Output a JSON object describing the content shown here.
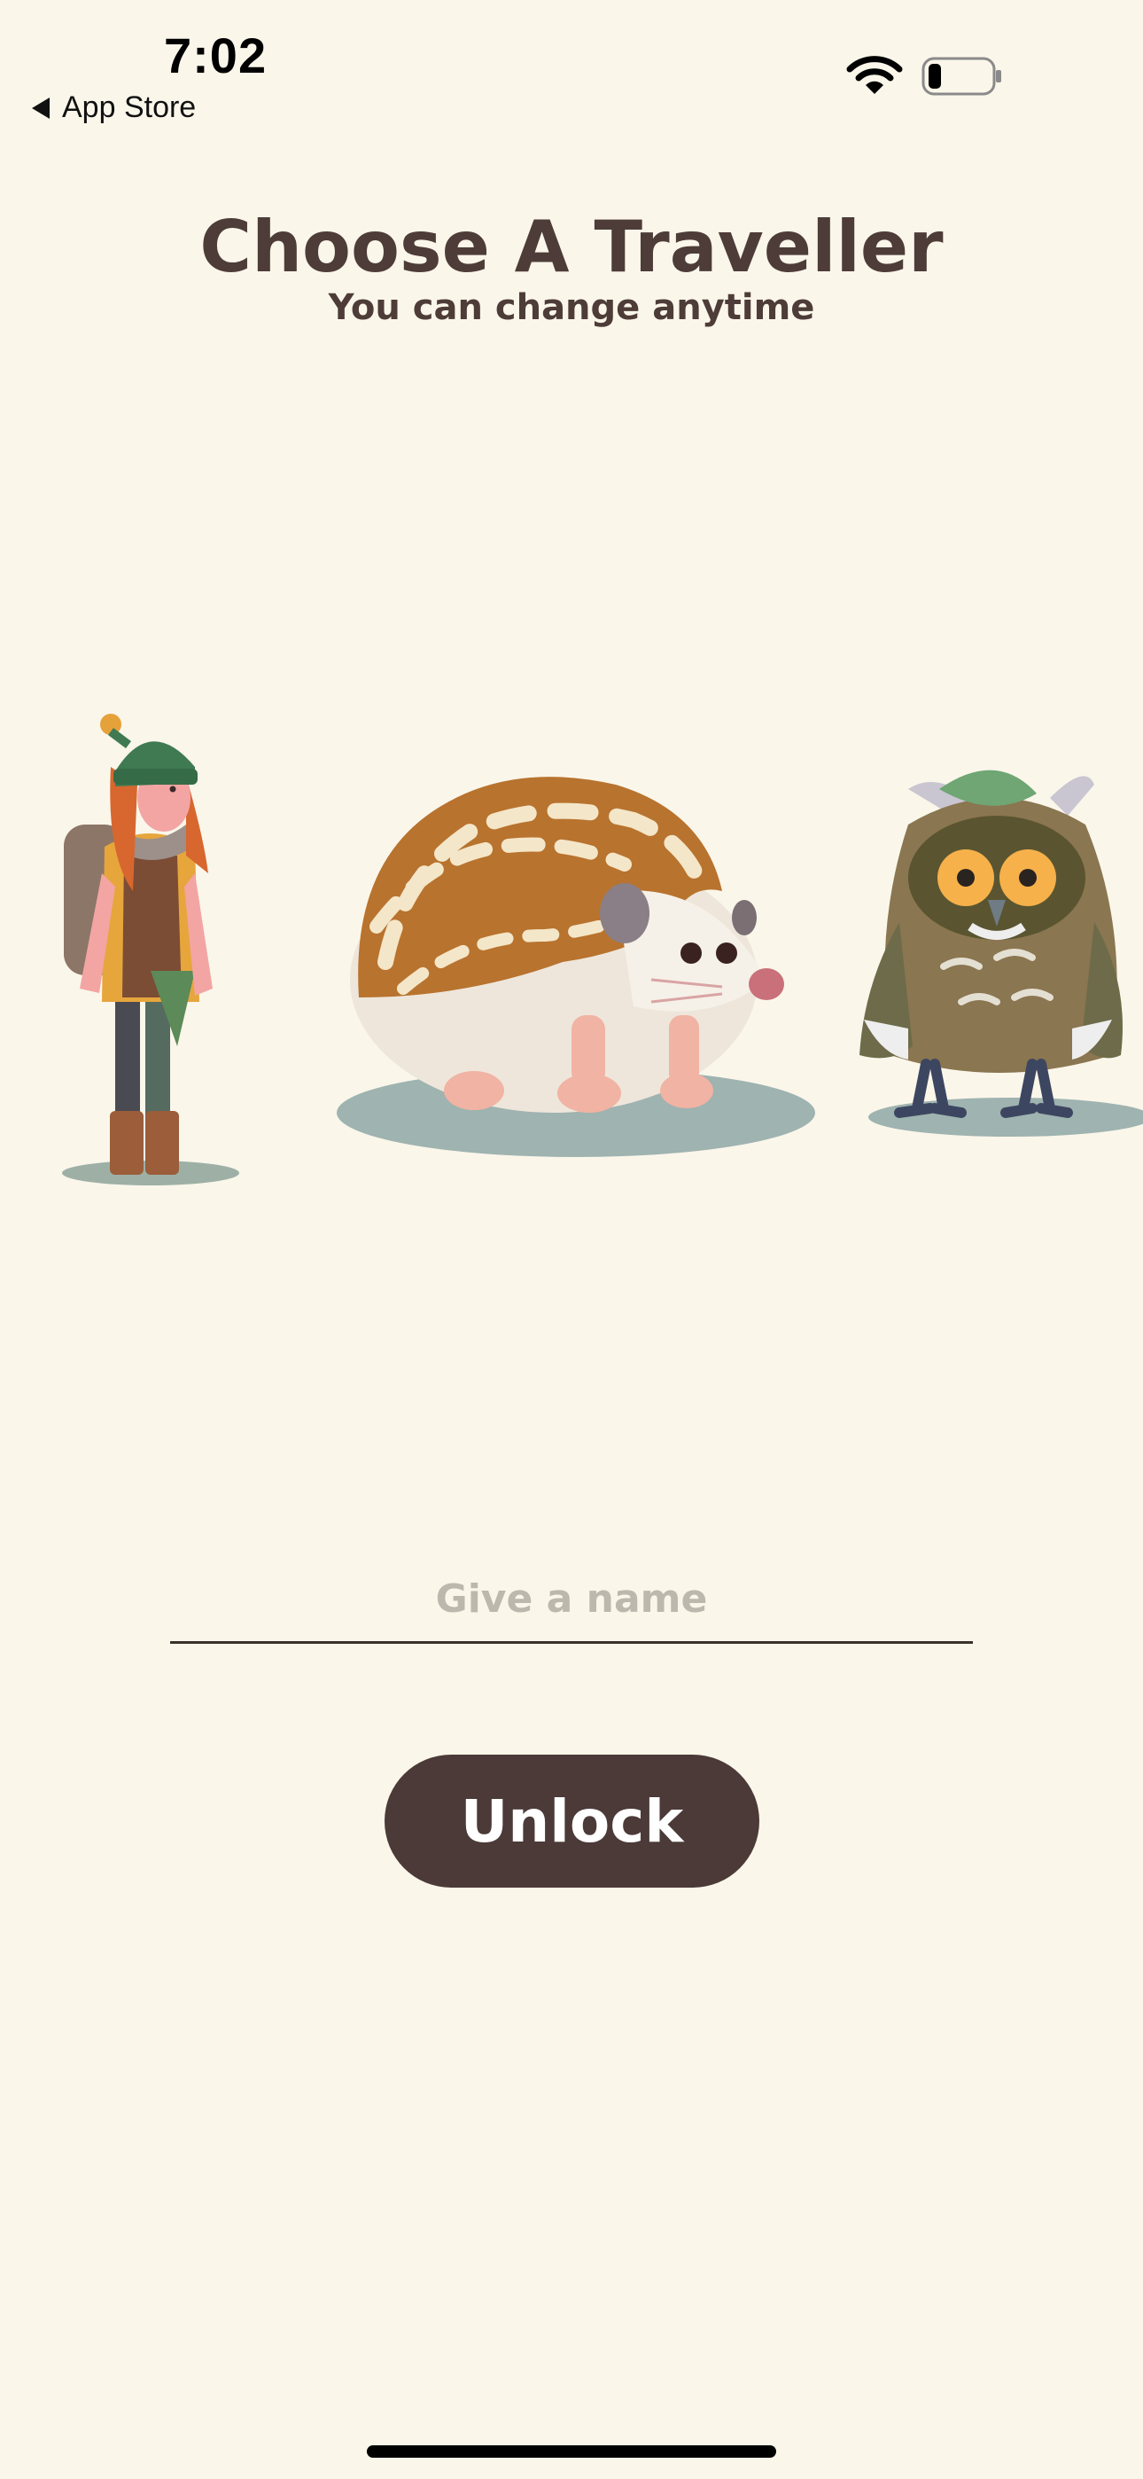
{
  "status_bar": {
    "time": "7:02",
    "back_label": "App Store",
    "wifi_icon": "wifi-icon",
    "battery_icon": "battery-low-icon"
  },
  "header": {
    "title": "Choose A Traveller",
    "subtitle": "You can change anytime"
  },
  "travellers": [
    {
      "name": "hiker-girl",
      "icon": "traveller-girl-illustration"
    },
    {
      "name": "hedgehog",
      "icon": "traveller-hedgehog-illustration"
    },
    {
      "name": "owl",
      "icon": "traveller-owl-illustration"
    }
  ],
  "name_input": {
    "value": "",
    "placeholder": "Give a name"
  },
  "unlock_button": {
    "label": "Unlock"
  },
  "colors": {
    "background": "#faf6ea",
    "text": "#4d3c38",
    "button": "#4b3a38",
    "placeholder": "#bdb8ae"
  }
}
